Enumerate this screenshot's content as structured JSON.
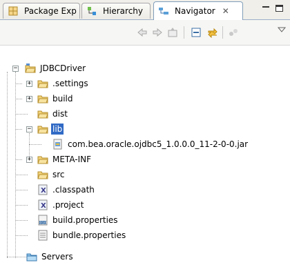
{
  "tabs": [
    {
      "label": "Package Exp",
      "icon": "package-explorer-icon",
      "active": false
    },
    {
      "label": "Hierarchy",
      "icon": "hierarchy-icon",
      "active": false
    },
    {
      "label": "Navigator",
      "icon": "navigator-icon",
      "active": true
    }
  ],
  "tab_close_glyph": "✕",
  "toolbar": {
    "buttons": [
      "back-icon",
      "forward-icon",
      "up-icon",
      "collapse-all-icon",
      "link-editor-icon",
      "menu-icon"
    ]
  },
  "tree": {
    "root": "JDBCDriver",
    "settings": ".settings",
    "build": "build",
    "dist": "dist",
    "lib": "lib",
    "jar": "com.bea.oracle.ojdbc5_1.0.0.0_11-2-0-0.jar",
    "metainf": "META-INF",
    "src": "src",
    "classpath": ".classpath",
    "project": ".project",
    "build_properties": "build.properties",
    "bundle_properties": "bundle.properties",
    "servers": "Servers"
  },
  "colors": {
    "selection": "#316ac5",
    "folder": "#f2c94c",
    "active_tab_border": "#7f9db9"
  }
}
